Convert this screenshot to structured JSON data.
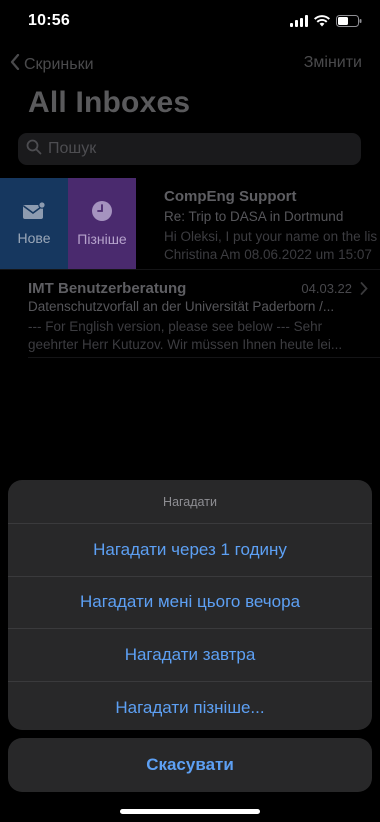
{
  "status_bar": {
    "time": "10:56"
  },
  "nav": {
    "back_label": "Скриньки",
    "edit_label": "Змінити"
  },
  "page_title": "All Inboxes",
  "search": {
    "placeholder": "Пошук"
  },
  "swipe_actions": {
    "new_label": "Нове",
    "later_label": "Пізніше"
  },
  "emails": [
    {
      "sender": "CompEng Support",
      "subject": "Re: Trip to DASA in Dortmund",
      "preview_line1": "Hi Oleksi, I put your name on the lis",
      "preview_line2": "Christina Am 08.06.2022 um 15:07"
    },
    {
      "sender": "IMT Benutzerberatung",
      "date": "04.03.22",
      "subject": "Datenschutzvorfall an der Universität Paderborn /...",
      "preview": "--- For English version, please see below --- Sehr geehrter Herr Kutuzov. Wir müssen Ihnen heute lei..."
    }
  ],
  "action_sheet": {
    "title": "Нагадати",
    "items": [
      "Нагадати через 1 годину",
      "Нагадати мені цього вечора",
      "Нагадати завтра",
      "Нагадати пізніше..."
    ],
    "cancel_label": "Скасувати"
  },
  "colors": {
    "accent": "#5da0f4",
    "new_action": "#16375f",
    "later_action": "#4a2a6e"
  }
}
